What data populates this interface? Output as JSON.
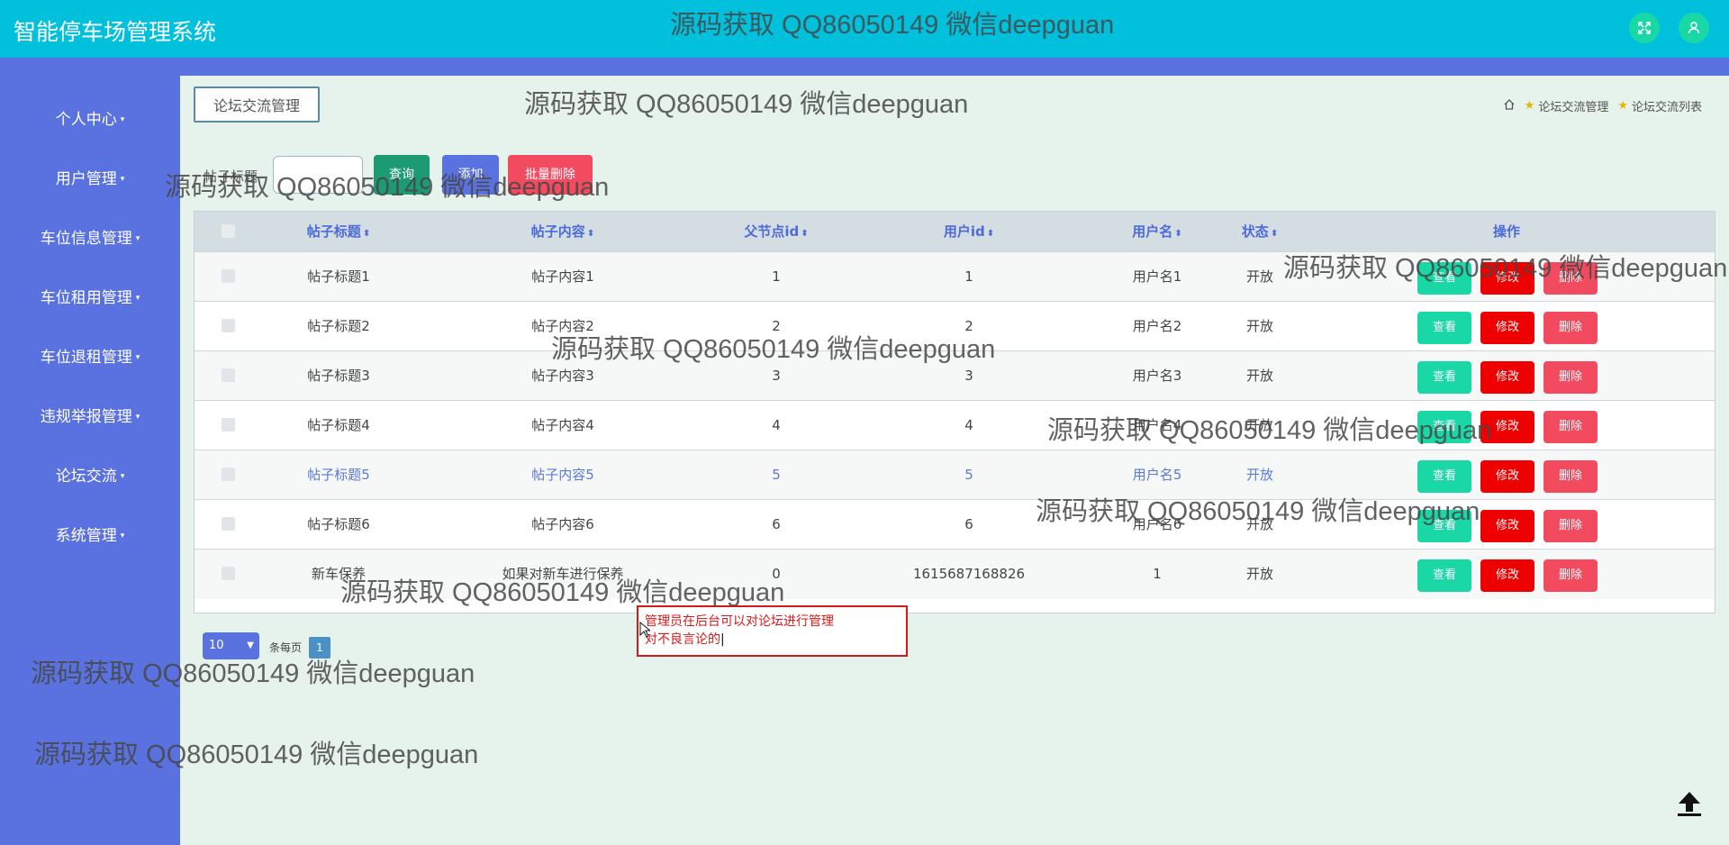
{
  "app": {
    "title": "智能停车场管理系统",
    "top_icons": [
      "fullscreen-icon",
      "user-icon"
    ]
  },
  "sidebar": {
    "items": [
      {
        "label": "个人中心"
      },
      {
        "label": "用户管理"
      },
      {
        "label": "车位信息管理"
      },
      {
        "label": "车位租用管理"
      },
      {
        "label": "车位退租管理"
      },
      {
        "label": "违规举报管理"
      },
      {
        "label": "论坛交流"
      },
      {
        "label": "系统管理"
      }
    ],
    "caret": "▾"
  },
  "page": {
    "section_tag": "论坛交流管理",
    "breadcrumb": [
      "论坛交流管理",
      "论坛交流列表"
    ]
  },
  "search": {
    "label": "帖子标题",
    "value": "",
    "buttons": {
      "query": "查询",
      "add": "添加",
      "batch_delete": "批量删除"
    }
  },
  "table": {
    "headers": [
      "帖子标题",
      "帖子内容",
      "父节点id",
      "用户id",
      "用户名",
      "状态",
      "操作"
    ],
    "sort_glyph": "⬍",
    "rows": [
      {
        "title": "帖子标题1",
        "content": "帖子内容1",
        "parent_id": "1",
        "user_id": "1",
        "username": "用户名1",
        "status": "开放"
      },
      {
        "title": "帖子标题2",
        "content": "帖子内容2",
        "parent_id": "2",
        "user_id": "2",
        "username": "用户名2",
        "status": "开放"
      },
      {
        "title": "帖子标题3",
        "content": "帖子内容3",
        "parent_id": "3",
        "user_id": "3",
        "username": "用户名3",
        "status": "开放"
      },
      {
        "title": "帖子标题4",
        "content": "帖子内容4",
        "parent_id": "4",
        "user_id": "4",
        "username": "用户名4",
        "status": "开放"
      },
      {
        "title": "帖子标题5",
        "content": "帖子内容5",
        "parent_id": "5",
        "user_id": "5",
        "username": "用户名5",
        "status": "开放"
      },
      {
        "title": "帖子标题6",
        "content": "帖子内容6",
        "parent_id": "6",
        "user_id": "6",
        "username": "用户名6",
        "status": "开放"
      },
      {
        "title": "新车保养",
        "content": "如果对新车进行保养",
        "parent_id": "0",
        "user_id": "1615687168826",
        "username": "1",
        "status": "开放"
      }
    ],
    "actions": {
      "view": "查看",
      "edit": "修改",
      "delete": "删除"
    }
  },
  "pagination": {
    "page_size": "10",
    "per_page_label": "条每页",
    "current_page": "1"
  },
  "annotation": {
    "lines": [
      "管理员在后台可以对论坛进行管理",
      "对不良言论的"
    ]
  },
  "watermark": "源码获取 QQ86050149 微信deepguan",
  "colors": {
    "header": "#00c0dc",
    "sidebar": "#5a72df",
    "view_button": "#19d8a6",
    "edit_button": "#ee0000",
    "delete_button": "#f24b5f",
    "query_button": "#1c9a72",
    "add_button": "#5a72df",
    "batch_delete_button": "#f24b5f"
  }
}
